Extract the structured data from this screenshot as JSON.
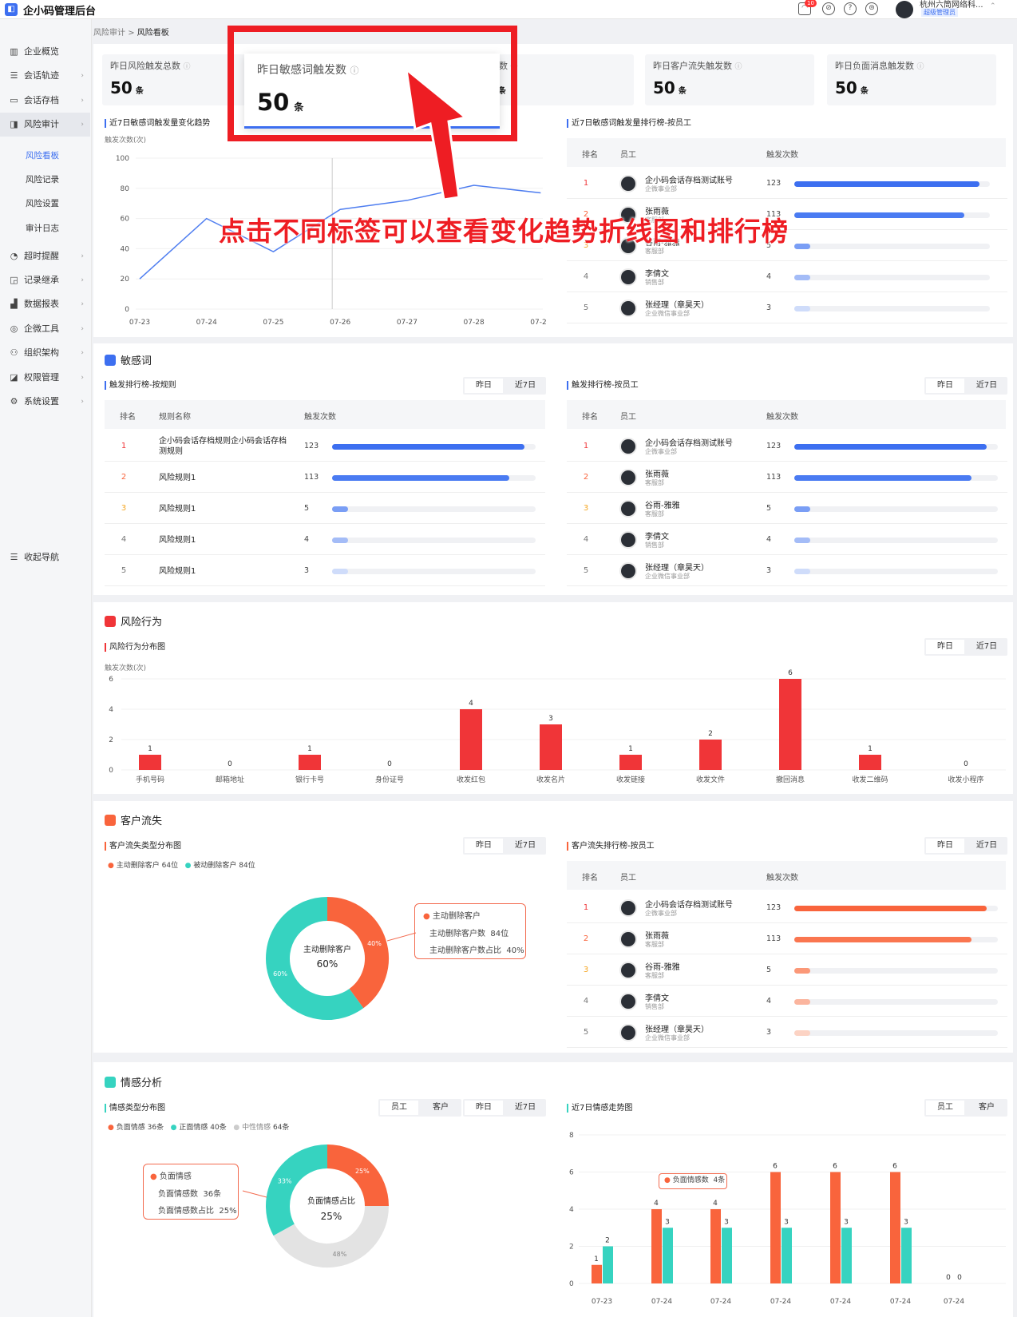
{
  "app": {
    "title": "企小码管理后台",
    "company": "杭州六筒网络科...",
    "role": "超级管理员",
    "notification_count": "10"
  },
  "sidebar": {
    "items": [
      {
        "label": "企业概览",
        "icon": "building-icon",
        "glyph": "▥"
      },
      {
        "label": "会话轨迹",
        "icon": "list-icon",
        "glyph": "☰"
      },
      {
        "label": "会话存档",
        "icon": "folder-icon",
        "glyph": "▭"
      },
      {
        "label": "风险审计",
        "icon": "audit-icon",
        "glyph": "◨"
      },
      {
        "label": "超时提醒",
        "icon": "bell-icon",
        "glyph": "◔"
      },
      {
        "label": "记录继承",
        "icon": "inherit-icon",
        "glyph": "◲"
      },
      {
        "label": "数据报表",
        "icon": "chart-icon",
        "glyph": "▟"
      },
      {
        "label": "企微工具",
        "icon": "tool-icon",
        "glyph": "◎"
      },
      {
        "label": "组织架构",
        "icon": "org-icon",
        "glyph": "⚇"
      },
      {
        "label": "权限管理",
        "icon": "key-icon",
        "glyph": "◪"
      },
      {
        "label": "系统设置",
        "icon": "gear-icon",
        "glyph": "⚙"
      }
    ],
    "sub_items": [
      "风险看板",
      "风险记录",
      "风险设置",
      "审计日志"
    ],
    "collapse_label": "收起导航"
  },
  "breadcrumb": {
    "parent": "风险审计",
    "current": "风险看板"
  },
  "stats": [
    {
      "label": "昨日风险触发总数",
      "value": "50",
      "unit": "条"
    },
    {
      "label": "昨日敏感词触发数",
      "value": "50",
      "unit": "条"
    },
    {
      "label": "为触发数",
      "value": "50",
      "unit": "条"
    },
    {
      "label": "昨日客户流失触发数",
      "value": "50",
      "unit": "条"
    },
    {
      "label": "昨日负面消息触发数",
      "value": "50",
      "unit": "条"
    }
  ],
  "highlight": {
    "label": "昨日敏感词触发数",
    "value": "50",
    "unit": "条"
  },
  "annotation": "点击不同标签可以查看变化趋势折线图和排行榜",
  "trend": {
    "title": "近7日敏感词触发量变化趋势",
    "ylabel": "触发次数(次)"
  },
  "trend_rank": {
    "title": "近7日敏感词触发量排行榜-按员工"
  },
  "table_headers": {
    "rank": "排名",
    "rule": "规则名称",
    "employee": "员工",
    "count": "触发次数"
  },
  "toggle": {
    "yesterday": "昨日",
    "week": "近7日",
    "employee": "员工",
    "customer": "客户"
  },
  "employees": [
    {
      "rank": "1",
      "name": "企小码会话存档测试账号",
      "dept": "企微事业部",
      "count": 123
    },
    {
      "rank": "2",
      "name": "张雨薇",
      "dept": "客服部",
      "count": 113
    },
    {
      "rank": "3",
      "name": "谷雨-雅雅",
      "dept": "客服部",
      "count": 5
    },
    {
      "rank": "4",
      "name": "李倩文",
      "dept": "销售部",
      "count": 4
    },
    {
      "rank": "5",
      "name": "张经理（章昊天）",
      "dept": "企业微信事业部",
      "count": 3
    }
  ],
  "sensitive": {
    "title": "敏感词",
    "rule_rank_title": "触发排行榜-按规则",
    "emp_rank_title": "触发排行榜-按员工",
    "rules": [
      {
        "rank": "1",
        "name": "企小码会话存档规则企小码会话存档测规则",
        "count": 123
      },
      {
        "rank": "2",
        "name": "风险规则1",
        "count": 113
      },
      {
        "rank": "3",
        "name": "风险规则1",
        "count": 5
      },
      {
        "rank": "4",
        "name": "风险规则1",
        "count": 4
      },
      {
        "rank": "5",
        "name": "风险规则1",
        "count": 3
      }
    ]
  },
  "risk": {
    "title": "风险行为",
    "chart_title": "风险行为分布图",
    "ylabel": "触发次数(次)"
  },
  "churn": {
    "title": "客户流失",
    "dist_title": "客户流失类型分布图",
    "rank_title": "客户流失排行榜-按员工",
    "legend": [
      {
        "label": "主动删除客户",
        "count": "64位"
      },
      {
        "label": "被动删除客户",
        "count": "84位"
      }
    ],
    "center_label": "主动删除客户",
    "center_value": "60%",
    "slice_labels": [
      "40%",
      "60%"
    ],
    "tooltip": {
      "title": "主动删除客户",
      "line1": "主动删除客户数",
      "val1": "84位",
      "line2": "主动删除客户数占比",
      "val2": "40%"
    }
  },
  "emotion": {
    "title": "情感分析",
    "dist_title": "情感类型分布图",
    "trend_title": "近7日情感走势图",
    "legend": [
      {
        "label": "负面情感",
        "count": "36条"
      },
      {
        "label": "正面情感",
        "count": "40条"
      },
      {
        "label": "中性情感",
        "count": "64条"
      }
    ],
    "center_label": "负面情感占比",
    "center_value": "25%",
    "slice_labels": [
      "25%",
      "48%",
      "33%"
    ],
    "tooltip": {
      "title": "负面情感",
      "line1": "负面情感数",
      "val1": "36条",
      "line2": "负面情感数占比",
      "val2": "25%"
    },
    "bar_tooltip": {
      "label": "负面情感数",
      "value": "4条"
    }
  },
  "colors": {
    "primary": "#3d6ff0",
    "red": "#f03538",
    "orange": "#f9643c",
    "teal": "#36d3c0",
    "grey": "#e3e3e3"
  },
  "chart_data": [
    {
      "type": "line",
      "title": "近7日敏感词触发量变化趋势",
      "ylabel": "触发次数(次)",
      "x": [
        "07-23",
        "07-24",
        "07-25",
        "07-26",
        "07-27",
        "07-28",
        "07-29"
      ],
      "values": [
        20,
        60,
        38,
        66,
        72,
        82,
        77
      ],
      "ylim": [
        0,
        100
      ],
      "yticks": [
        0,
        20,
        40,
        60,
        80,
        100
      ]
    },
    {
      "type": "bar",
      "title": "风险行为分布图",
      "ylabel": "触发次数(次)",
      "categories": [
        "手机号码",
        "邮箱地址",
        "银行卡号",
        "身份证号",
        "收发红包",
        "收发名片",
        "收发链接",
        "收发文件",
        "撤回消息",
        "收发二维码",
        "收发小程序"
      ],
      "values": [
        1,
        0,
        1,
        0,
        4,
        3,
        1,
        2,
        6,
        1,
        0
      ],
      "ylim": [
        0,
        6
      ],
      "yticks": [
        0,
        2,
        4,
        6
      ]
    },
    {
      "type": "pie",
      "title": "客户流失类型分布图",
      "slices": [
        {
          "name": "主动删除客户",
          "value": 40
        },
        {
          "name": "被动删除客户",
          "value": 60
        }
      ]
    },
    {
      "type": "pie",
      "title": "情感类型分布图",
      "slices": [
        {
          "name": "负面情感",
          "value": 25
        },
        {
          "name": "中性情感",
          "value": 42
        },
        {
          "name": "正面情感",
          "value": 33
        }
      ]
    },
    {
      "type": "bar",
      "title": "近7日情感走势图",
      "categories": [
        "07-23",
        "07-24",
        "07-24",
        "07-24",
        "07-24",
        "07-24",
        "07-24"
      ],
      "series": [
        {
          "values": [
            1,
            4,
            4,
            6,
            6,
            6,
            0
          ]
        },
        {
          "values": [
            2,
            3,
            3,
            3,
            3,
            3,
            0
          ]
        }
      ],
      "ylim": [
        0,
        8
      ],
      "yticks": [
        0,
        2,
        4,
        6,
        8
      ]
    }
  ]
}
